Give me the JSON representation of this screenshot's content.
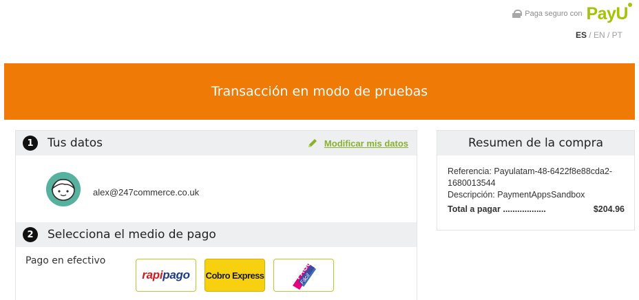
{
  "header": {
    "secure_label": "Paga seguro con",
    "brand": "PayU",
    "languages": [
      {
        "code": "ES",
        "active": true
      },
      {
        "code": "EN",
        "active": false
      },
      {
        "code": "PT",
        "active": false
      }
    ]
  },
  "banner": {
    "text": "Transacción en modo de pruebas",
    "color": "#f07a06"
  },
  "steps": [
    {
      "number": "1",
      "title": "Tus datos",
      "action_label": "Modificar mis datos",
      "user_email": "alex@247commerce.co.uk"
    },
    {
      "number": "2",
      "title": "Selecciona el medio de pago",
      "payment_category": "Pago en efectivo",
      "methods": [
        {
          "name": "rapipago",
          "part1": "rapi",
          "part2": "pago"
        },
        {
          "name": "Cobro Express"
        },
        {
          "name": "Pago Fácil",
          "top": "PAGO",
          "bottom": "Fácil"
        }
      ]
    }
  ],
  "summary": {
    "title": "Resumen de la compra",
    "reference_label": "Referencia:",
    "reference_value": "Payulatam-48-6422f8e88cda2-1680013544",
    "description_label": "Descripción:",
    "description_value": "PaymentAppsSandbox",
    "total_label": "Total a pagar ..................",
    "total_value": "$204.96"
  },
  "colors": {
    "accent_green": "#a6c307",
    "link_green": "#8bb02b",
    "avatar_teal": "#56b29f"
  }
}
